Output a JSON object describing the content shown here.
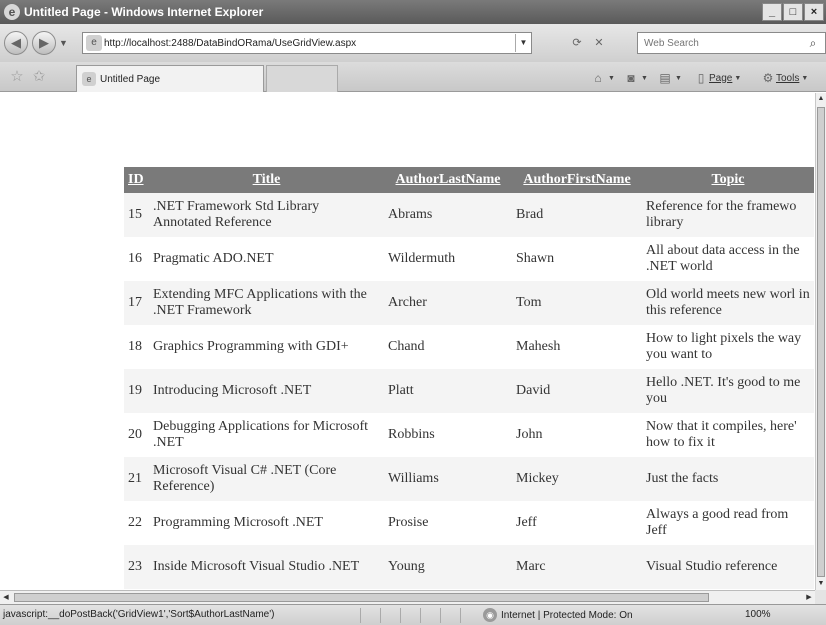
{
  "window": {
    "title": "Untitled Page - Windows Internet Explorer",
    "minimize_glyph": "_",
    "maximize_glyph": "□",
    "close_glyph": "×"
  },
  "addressbar": {
    "url": "http://localhost:2488/DataBindORama/UseGridView.aspx",
    "search_placeholder": "Web Search"
  },
  "tabs": {
    "active_tab_label": "Untitled Page"
  },
  "commandbar": {
    "page_label": "Page",
    "tools_label": "Tools"
  },
  "grid": {
    "columns": [
      "ID",
      "Title",
      "AuthorLastName",
      "AuthorFirstName",
      "Topic"
    ],
    "rows": [
      {
        "id": "15",
        "title": ".NET Framework Std Library Annotated Reference",
        "last": "Abrams",
        "first": "Brad",
        "topic": "Reference for the framewo library"
      },
      {
        "id": "16",
        "title": "Pragmatic ADO.NET",
        "last": "Wildermuth",
        "first": "Shawn",
        "topic": "All about data access in the .NET world"
      },
      {
        "id": "17",
        "title": "Extending MFC Applications with the .NET Framework",
        "last": "Archer",
        "first": "Tom",
        "topic": "Old world meets new worl in this reference"
      },
      {
        "id": "18",
        "title": "Graphics Programming with GDI+",
        "last": "Chand",
        "first": "Mahesh",
        "topic": "How to light pixels the way you want to"
      },
      {
        "id": "19",
        "title": "Introducing Microsoft .NET",
        "last": "Platt",
        "first": "David",
        "topic": "Hello .NET. It's good to me you"
      },
      {
        "id": "20",
        "title": "Debugging Applications for Microsoft .NET",
        "last": "Robbins",
        "first": "John",
        "topic": "Now that it compiles, here' how to fix it"
      },
      {
        "id": "21",
        "title": "Microsoft Visual C# .NET (Core Reference)",
        "last": "Williams",
        "first": "Mickey",
        "topic": "Just the facts"
      },
      {
        "id": "22",
        "title": "Programming Microsoft .NET",
        "last": "Prosise",
        "first": "Jeff",
        "topic": "Always a good read from Jeff"
      },
      {
        "id": "23",
        "title": "Inside Microsoft Visual Studio .NET",
        "last": "Young",
        "first": "Marc",
        "topic": "Visual Studio reference"
      }
    ]
  },
  "statusbar": {
    "text": "javascript:__doPostBack('GridView1','Sort$AuthorLastName')",
    "zone": "Internet | Protected Mode: On",
    "zoom": "100%"
  },
  "icons": {
    "ie_logo": "ie-logo-icon",
    "back": "back-arrow-icon",
    "forward": "forward-arrow-icon",
    "refresh": "refresh-icon",
    "stop": "stop-icon",
    "search": "search-icon",
    "favorites": "favorites-star-icon",
    "add_favorites": "add-favorites-icon",
    "home": "home-icon",
    "feeds": "feeds-icon",
    "print": "print-icon",
    "page": "page-icon",
    "tools": "tools-gear-icon",
    "globe": "internet-zone-icon"
  },
  "colors": {
    "header_bg": "#7a7a7a",
    "header_text": "#ffffff",
    "alt_row_bg": "#f4f4f4",
    "titlebar_bg": "#6a6a6a"
  }
}
